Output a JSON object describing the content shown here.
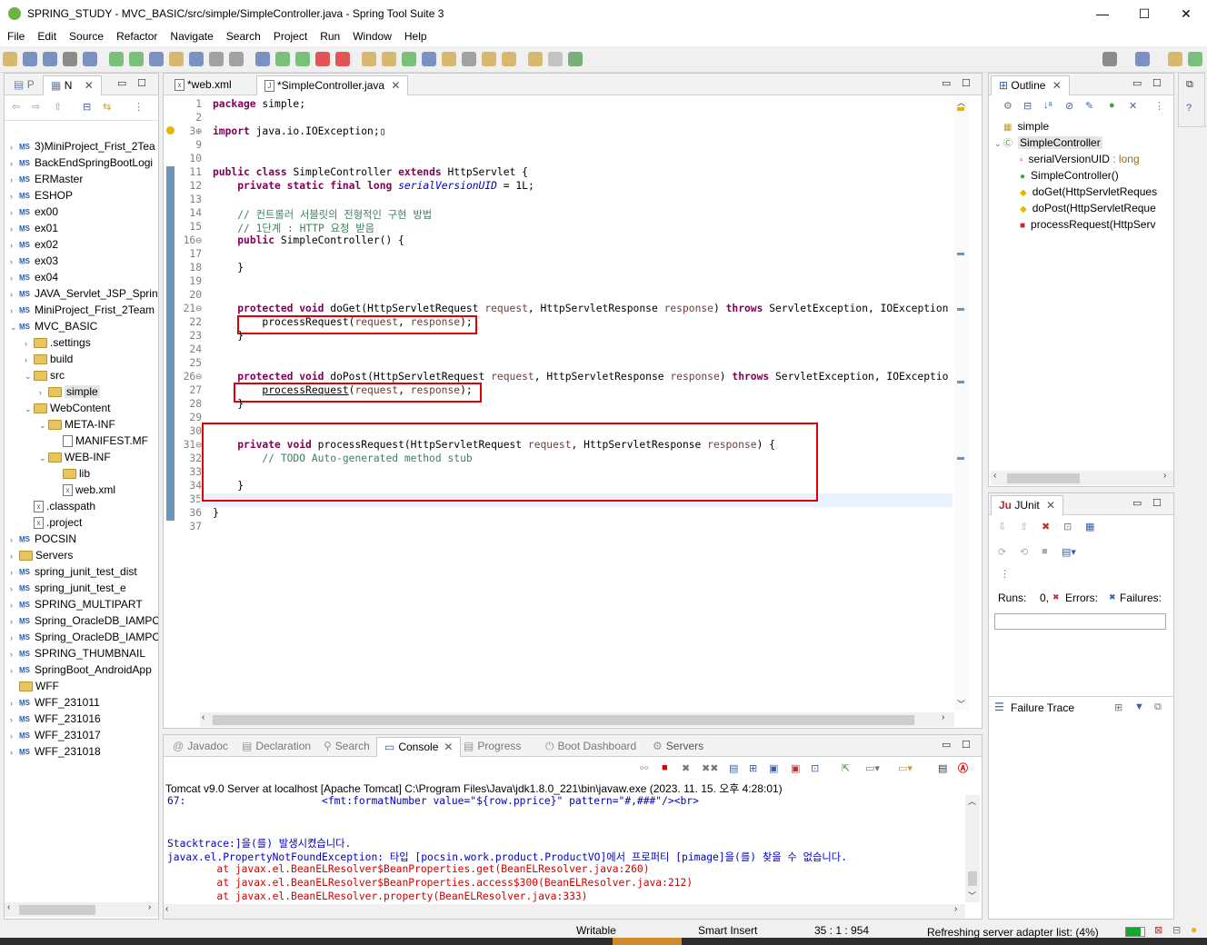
{
  "window": {
    "title": "SPRING_STUDY - MVC_BASIC/src/simple/SimpleController.java - Spring Tool Suite 3",
    "minimize": "—",
    "maximize": "☐",
    "close": "✕"
  },
  "menu": [
    "File",
    "Edit",
    "Source",
    "Refactor",
    "Navigate",
    "Search",
    "Project",
    "Run",
    "Window",
    "Help"
  ],
  "left_panel": {
    "tabs": [
      "P",
      "N"
    ],
    "tree": [
      {
        "label": "3)MiniProject_Frist_2Tea",
        "indent": 0,
        "type": "project",
        "tw": "›"
      },
      {
        "label": "BackEndSpringBootLogi",
        "indent": 0,
        "type": "project",
        "tw": "›"
      },
      {
        "label": "ERMaster",
        "indent": 0,
        "type": "project",
        "tw": "›"
      },
      {
        "label": "ESHOP",
        "indent": 0,
        "type": "project",
        "tw": "›"
      },
      {
        "label": "ex00",
        "indent": 0,
        "type": "project",
        "tw": "›"
      },
      {
        "label": "ex01",
        "indent": 0,
        "type": "project",
        "tw": "›"
      },
      {
        "label": "ex02",
        "indent": 0,
        "type": "project",
        "tw": "›"
      },
      {
        "label": "ex03",
        "indent": 0,
        "type": "project",
        "tw": "›"
      },
      {
        "label": "ex04",
        "indent": 0,
        "type": "project",
        "tw": "›"
      },
      {
        "label": "JAVA_Servlet_JSP_Spring",
        "indent": 0,
        "type": "project",
        "tw": "›"
      },
      {
        "label": "MiniProject_Frist_2Team",
        "indent": 0,
        "type": "project",
        "tw": "›"
      },
      {
        "label": "MVC_BASIC",
        "indent": 0,
        "type": "project",
        "tw": "⌄"
      },
      {
        "label": ".settings",
        "indent": 1,
        "type": "folder",
        "tw": "›"
      },
      {
        "label": "build",
        "indent": 1,
        "type": "folder",
        "tw": "›"
      },
      {
        "label": "src",
        "indent": 1,
        "type": "folder",
        "tw": "⌄"
      },
      {
        "label": "simple",
        "indent": 2,
        "type": "folder",
        "tw": "›",
        "selected": true
      },
      {
        "label": "WebContent",
        "indent": 1,
        "type": "folder",
        "tw": "⌄"
      },
      {
        "label": "META-INF",
        "indent": 2,
        "type": "folder",
        "tw": "⌄"
      },
      {
        "label": "MANIFEST.MF",
        "indent": 3,
        "type": "file",
        "tw": ""
      },
      {
        "label": "WEB-INF",
        "indent": 2,
        "type": "folder",
        "tw": "⌄"
      },
      {
        "label": "lib",
        "indent": 3,
        "type": "folder",
        "tw": ""
      },
      {
        "label": "web.xml",
        "indent": 3,
        "type": "xml",
        "tw": ""
      },
      {
        "label": ".classpath",
        "indent": 1,
        "type": "xml",
        "tw": ""
      },
      {
        "label": ".project",
        "indent": 1,
        "type": "xml",
        "tw": ""
      },
      {
        "label": "POCSIN",
        "indent": 0,
        "type": "project",
        "tw": "›"
      },
      {
        "label": "Servers",
        "indent": 0,
        "type": "folder",
        "tw": "›"
      },
      {
        "label": "spring_junit_test_dist",
        "indent": 0,
        "type": "project",
        "tw": "›"
      },
      {
        "label": "spring_junit_test_e",
        "indent": 0,
        "type": "project",
        "tw": "›"
      },
      {
        "label": "SPRING_MULTIPART",
        "indent": 0,
        "type": "project",
        "tw": "›"
      },
      {
        "label": "Spring_OracleDB_IAMPC",
        "indent": 0,
        "type": "project",
        "tw": "›"
      },
      {
        "label": "Spring_OracleDB_IAMPC",
        "indent": 0,
        "type": "project",
        "tw": "›"
      },
      {
        "label": "SPRING_THUMBNAIL",
        "indent": 0,
        "type": "project",
        "tw": "›"
      },
      {
        "label": "SpringBoot_AndroidApp",
        "indent": 0,
        "type": "project",
        "tw": "›"
      },
      {
        "label": "WFF",
        "indent": 0,
        "type": "folder",
        "tw": ""
      },
      {
        "label": "WFF_231011",
        "indent": 0,
        "type": "project",
        "tw": "›"
      },
      {
        "label": "WFF_231016",
        "indent": 0,
        "type": "project",
        "tw": "›"
      },
      {
        "label": "WFF_231017",
        "indent": 0,
        "type": "project",
        "tw": "›"
      },
      {
        "label": "WFF_231018",
        "indent": 0,
        "type": "project",
        "tw": "›"
      }
    ]
  },
  "editor": {
    "tabs": [
      "*web.xml",
      "*SimpleController.java"
    ],
    "lines": [
      {
        "n": "1",
        "html": "<span class=\"kw\">package</span> simple;"
      },
      {
        "n": "2",
        "html": ""
      },
      {
        "n": "3⊕",
        "html": "<span class=\"kw\">import</span> java.io.IOException;▯"
      },
      {
        "n": "9",
        "html": ""
      },
      {
        "n": "10",
        "html": ""
      },
      {
        "n": "11",
        "html": "<span class=\"kw\">public</span> <span class=\"kw\">class</span> SimpleController <span class=\"kw\">extends</span> HttpServlet {"
      },
      {
        "n": "12",
        "html": "    <span class=\"kw\">private</span> <span class=\"kw\">static</span> <span class=\"kw\">final</span> <span class=\"kw\">long</span> <span class=\"fld\">serialVersionUID</span> = 1L;"
      },
      {
        "n": "13",
        "html": ""
      },
      {
        "n": "14",
        "html": "    <span class=\"cm\">// 컨트롤러 서블릿의 전형적인 구현 방법</span>"
      },
      {
        "n": "15",
        "html": "    <span class=\"cm\">// 1단계 : HTTP 요청 받음</span>"
      },
      {
        "n": "16⊖",
        "html": "    <span class=\"kw\">public</span> SimpleController() {"
      },
      {
        "n": "17",
        "html": ""
      },
      {
        "n": "18",
        "html": "    }"
      },
      {
        "n": "19",
        "html": ""
      },
      {
        "n": "20",
        "html": ""
      },
      {
        "n": "21⊖",
        "html": "    <span class=\"kw\">protected</span> <span class=\"kw\">void</span> doGet(HttpServletRequest <span class=\"pm\">request</span>, HttpServletResponse <span class=\"pm\">response</span>) <span class=\"kw\">throws</span> ServletException, IOException"
      },
      {
        "n": "22",
        "html": "        processRequest(<span class=\"pm\">request</span>, <span class=\"pm\">response</span>);"
      },
      {
        "n": "23",
        "html": "    }"
      },
      {
        "n": "24",
        "html": ""
      },
      {
        "n": "25",
        "html": ""
      },
      {
        "n": "26⊖",
        "html": "    <span class=\"kw\">protected</span> <span class=\"kw\">void</span> doPost(HttpServletRequest <span class=\"pm\">request</span>, HttpServletResponse <span class=\"pm\">response</span>) <span class=\"kw\">throws</span> ServletException, IOExceptio"
      },
      {
        "n": "27",
        "html": "        <span class=\"ul\">processRequest</span>(<span class=\"pm\">request</span>, <span class=\"pm\">response</span>);"
      },
      {
        "n": "28",
        "html": "    }"
      },
      {
        "n": "29",
        "html": ""
      },
      {
        "n": "30",
        "html": ""
      },
      {
        "n": "31⊖",
        "html": "    <span class=\"kw\">private</span> <span class=\"kw\">void</span> processRequest(HttpServletRequest <span class=\"pm\">request</span>, HttpServletResponse <span class=\"pm\">response</span>) {"
      },
      {
        "n": "32",
        "html": "        <span class=\"cm\">// TODO Auto-generated method stub</span>"
      },
      {
        "n": "33",
        "html": ""
      },
      {
        "n": "34",
        "html": "    }"
      },
      {
        "n": "35",
        "html": ""
      },
      {
        "n": "36",
        "html": "}"
      },
      {
        "n": "37",
        "html": ""
      }
    ]
  },
  "outline": {
    "tab": "Outline",
    "items": [
      {
        "label": "simple",
        "type": "pkg",
        "indent": 0
      },
      {
        "label": "SimpleController",
        "type": "class",
        "indent": 0,
        "tw": "⌄"
      },
      {
        "label": "serialVersionUID",
        "suffix": " : long",
        "type": "field",
        "indent": 1
      },
      {
        "label": "SimpleController()",
        "type": "ctor",
        "indent": 1
      },
      {
        "label": "doGet(HttpServletReques",
        "type": "prot",
        "indent": 1
      },
      {
        "label": "doPost(HttpServletReque",
        "type": "prot",
        "indent": 1
      },
      {
        "label": "processRequest(HttpServ",
        "type": "priv",
        "indent": 1
      }
    ]
  },
  "junit": {
    "tab": "JUnit",
    "runs_label": "Runs:",
    "runs_value": "0,",
    "errors_label": "Errors:",
    "failures_label": "Failures:",
    "failure_trace": "Failure Trace"
  },
  "bottom": {
    "tabs": [
      "Javadoc",
      "Declaration",
      "Search",
      "Console",
      "Progress",
      "Boot Dashboard",
      "Servers"
    ],
    "server_line": "Tomcat v9.0 Server at localhost [Apache Tomcat] C:\\Program Files\\Java\\jdk1.8.0_221\\bin\\javaw.exe  (2023. 11. 15. 오후 4:28:01)",
    "console": [
      {
        "text": "67:                      <fmt:formatNumber value=\"${row.pprice}\" pattern=\"#,###\"/><br>",
        "color": "#0000c0"
      },
      {
        "text": "",
        "color": "#000"
      },
      {
        "text": "",
        "color": "#000"
      },
      {
        "text": "Stacktrace:]을(를) 발생시켰습니다.",
        "color": "#0000c0"
      },
      {
        "text": "javax.el.PropertyNotFoundException: 타입 [pocsin.work.product.ProductVO]에서 프로퍼티 [pimage]을(를) 찾을 수 없습니다.",
        "color": "#0000c0"
      },
      {
        "text": "        at javax.el.BeanELResolver$BeanProperties.get(BeanELResolver.java:260)",
        "color": "#d00000"
      },
      {
        "text": "        at javax.el.BeanELResolver$BeanProperties.access$300(BeanELResolver.java:212)",
        "color": "#d00000"
      },
      {
        "text": "        at javax.el.BeanELResolver.property(BeanELResolver.java:333)",
        "color": "#d00000"
      }
    ]
  },
  "status": {
    "writable": "Writable",
    "insert": "Smart Insert",
    "position": "35 : 1 : 954",
    "progress": "Refreshing server adapter list: (4%)"
  }
}
